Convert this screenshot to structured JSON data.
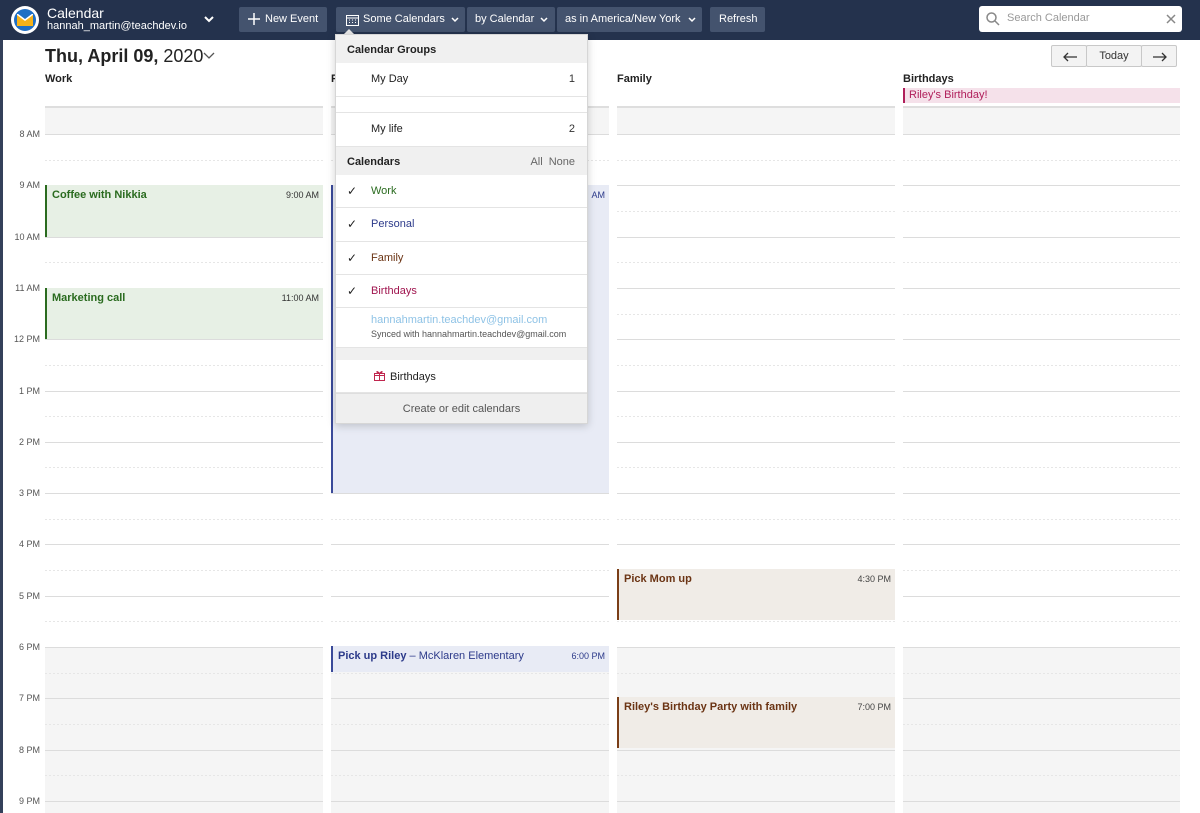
{
  "app": {
    "title": "Calendar",
    "user": "hannah_martin@teachdev.io"
  },
  "toolbar": {
    "new_event": "New Event",
    "calendars_select": "Some Calendars",
    "view_select": "by Calendar",
    "timezone_select": "as in America/New York",
    "refresh": "Refresh"
  },
  "search": {
    "placeholder": "Search Calendar"
  },
  "header": {
    "date": "Thu, April 09,",
    "year": "2020",
    "today": "Today"
  },
  "columns": [
    {
      "name": "Work"
    },
    {
      "name": "P"
    },
    {
      "name": "Family"
    },
    {
      "name": "Birthdays"
    }
  ],
  "allday": {
    "birthday_event": "Riley's Birthday!"
  },
  "time_labels": [
    "8 AM",
    "9 AM",
    "10 AM",
    "11 AM",
    "12 PM",
    "1 PM",
    "2 PM",
    "3 PM",
    "4 PM",
    "5 PM",
    "6 PM",
    "7 PM",
    "8 PM",
    "9 PM"
  ],
  "events": {
    "coffee": {
      "title": "Coffee with Nikkia",
      "time": "9:00 AM"
    },
    "marketing": {
      "title": "Marketing call",
      "time": "11:00 AM"
    },
    "personal_block": {
      "time_fragment": "AM"
    },
    "pickup": {
      "title": "Pick up Riley",
      "location": " – McKlaren Elementary",
      "time": "6:00 PM"
    },
    "pick_mom": {
      "title": "Pick Mom up",
      "time": "4:30 PM"
    },
    "party": {
      "title": "Riley's Birthday Party with family",
      "time": "7:00 PM"
    }
  },
  "dropdown": {
    "groups_header": "Calendar Groups",
    "groups": [
      {
        "label": "My Day",
        "count": "1"
      },
      {
        "label": "My life",
        "count": "2"
      }
    ],
    "calendars_header": "Calendars",
    "all": "All",
    "none": "None",
    "calendars": [
      {
        "label": "Work",
        "color": "#2a6b1f"
      },
      {
        "label": "Personal",
        "color": "#2c3a8a"
      },
      {
        "label": "Family",
        "color": "#6b3414"
      },
      {
        "label": "Birthdays",
        "color": "#a0154f"
      }
    ],
    "synced_account": "hannahmartin.teachdev@gmail.com",
    "synced_note": "Synced with hannahmartin.teachdev@gmail.com",
    "birthdays_item": "Birthdays",
    "footer": "Create or edit calendars"
  }
}
